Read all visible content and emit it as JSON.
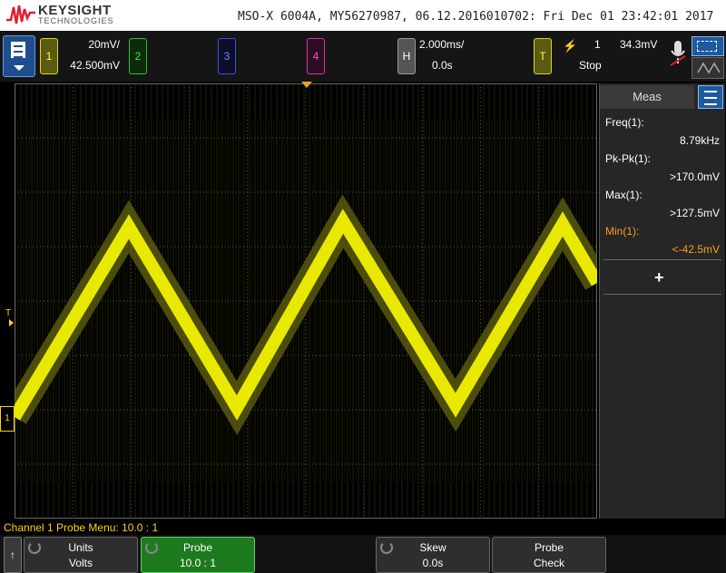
{
  "header": {
    "brand": "KEYSIGHT",
    "brand_sub": "TECHNOLOGIES",
    "instrument_info": "MSO-X 6004A, MY56270987, 06.12.2016010702: Fri Dec 01 23:42:01 2017"
  },
  "channels": {
    "ch1": {
      "label": "1",
      "scale": "20mV/",
      "offset": "42.500mV",
      "color": "#ffff00"
    },
    "ch2": {
      "label": "2",
      "color": "#40e040"
    },
    "ch3": {
      "label": "3",
      "color": "#7080ff"
    },
    "ch4": {
      "label": "4",
      "color": "#ff50c0"
    }
  },
  "horizontal": {
    "label": "H",
    "timebase": "2.000ms/",
    "delay": "0.0s"
  },
  "trigger": {
    "label": "T",
    "source": "1",
    "level": "34.3mV",
    "status": "Stop"
  },
  "plot": {
    "trigger_marker": "T",
    "channel_marker": "1"
  },
  "side_panel": {
    "tab": "Meas",
    "measurements": [
      {
        "label": "Freq(1):",
        "value": "8.79kHz",
        "highlight": false
      },
      {
        "label": "Pk-Pk(1):",
        "value": ">170.0mV",
        "highlight": false
      },
      {
        "label": "Max(1):",
        "value": ">127.5mV",
        "highlight": false
      },
      {
        "label": "Min(1):",
        "value": "<-42.5mV",
        "highlight": true
      }
    ],
    "add_label": "+"
  },
  "status_message": "Channel 1 Probe Menu: 10.0 : 1",
  "softkeys": {
    "back": "↑",
    "units": {
      "title": "Units",
      "value": "Volts"
    },
    "probe": {
      "title": "Probe",
      "value": "10.0 : 1"
    },
    "skew": {
      "title": "Skew",
      "value": "0.0s"
    },
    "probe_check": {
      "title": "Probe",
      "value": "Check"
    }
  },
  "waveform": {
    "color": "#e8e800",
    "shape": "triangle",
    "frequency": "8.79kHz",
    "max": "127.5mV",
    "min": "-42.5mV"
  }
}
